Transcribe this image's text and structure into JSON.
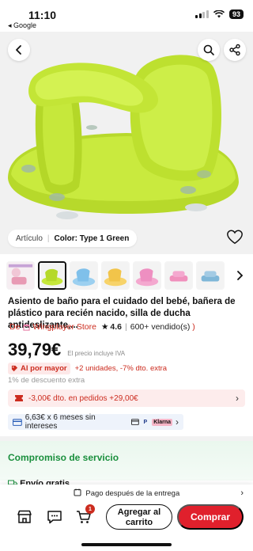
{
  "status_bar": {
    "time": "11:10",
    "back_app": "◂ Google",
    "battery": "93"
  },
  "variant": {
    "label": "Artículo",
    "color_label": "Color: Type 1 Green"
  },
  "product": {
    "title": "Asiento de baño para el cuidado del bebé, bañera de plástico para recién nacido, silla de ducha antideslizante,...",
    "store_prefix": "De",
    "store_name": "Wingplayer Store",
    "rating": "4.6",
    "sold": "600+ vendido(s)",
    "price": "39,79€",
    "price_note": "El precio incluye IVA",
    "mayor_badge": "Al por mayor",
    "mayor_promo": "+2 unidades, -7% dto. extra",
    "extra_discount": "1% de descuento extra",
    "coupon": "-3,00€ dto. en pedidos +29,00€",
    "installments": "6,63€ x 6 meses sin intereses"
  },
  "service": {
    "heading": "Compromiso de servicio",
    "shipping": "Envío gratis"
  },
  "bottom_bar": {
    "pay_later": "Pago después de la entrega",
    "cart_count": "1",
    "add_to_cart": "Agregar al carrito",
    "buy": "Comprar"
  },
  "colors": {
    "accent": "#e0202c",
    "price_red": "#cc2c1f",
    "service_green": "#1a8f3d",
    "product_green": "#c6e93b"
  },
  "icons": [
    "back-arrow-icon",
    "search-icon",
    "share-icon",
    "heart-icon",
    "store-icon",
    "chat-icon",
    "cart-icon",
    "star-icon"
  ]
}
